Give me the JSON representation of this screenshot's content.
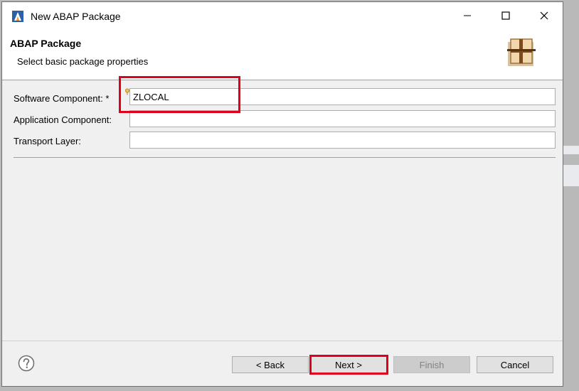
{
  "window": {
    "title": "New ABAP Package"
  },
  "banner": {
    "title": "ABAP Package",
    "subtitle": "Select basic package properties"
  },
  "form": {
    "software_component": {
      "label": "Software Component: *",
      "value": "ZLOCAL"
    },
    "application_component": {
      "label": "Application Component:",
      "value": ""
    },
    "transport_layer": {
      "label": "Transport Layer:",
      "value": ""
    }
  },
  "buttons": {
    "back": "< Back",
    "next": "Next >",
    "finish": "Finish",
    "cancel": "Cancel"
  },
  "icons": {
    "app": "eclipse-adt-icon",
    "banner": "package-icon",
    "help": "help-icon",
    "required": "required-field-decorator-icon"
  },
  "colors": {
    "highlight": "#e0001b",
    "banner_bg": "#ffffff",
    "dialog_bg": "#f0f0f0"
  }
}
